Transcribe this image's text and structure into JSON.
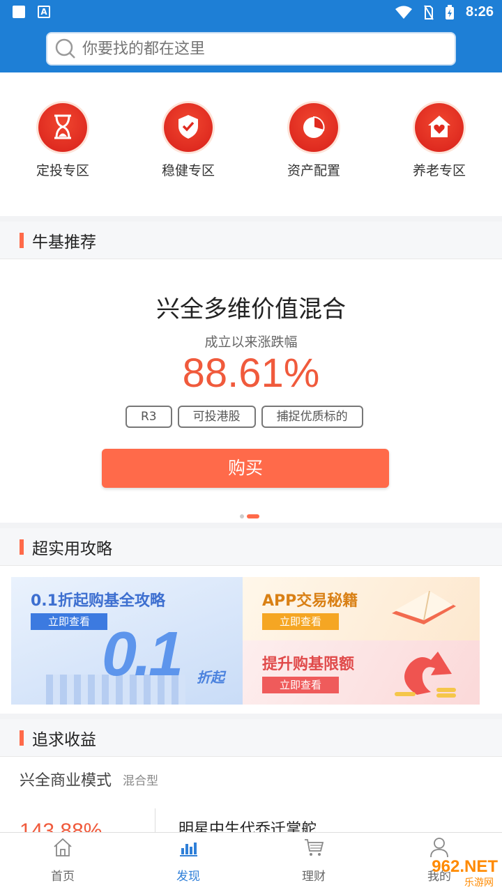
{
  "status_bar": {
    "time": "8:26"
  },
  "search": {
    "placeholder": "你要找的都在这里"
  },
  "categories": [
    {
      "label": "定投专区",
      "icon": "hourglass-icon"
    },
    {
      "label": "稳健专区",
      "icon": "shield-check-icon"
    },
    {
      "label": "资产配置",
      "icon": "pie-chart-icon"
    },
    {
      "label": "养老专区",
      "icon": "house-heart-icon"
    }
  ],
  "recommend": {
    "section_title": "牛基推荐",
    "fund_name": "兴全多维价值混合",
    "subtitle": "成立以来涨跌幅",
    "value": "88.61%",
    "tags": [
      "R3",
      "可投港股",
      "捕捉优质标的"
    ],
    "buy_label": "购买"
  },
  "strategy": {
    "section_title": "超实用攻略",
    "banners": [
      {
        "title": "0.1折起购基全攻略",
        "button": "立即查看",
        "big_text": "0.1",
        "badge": "折起"
      },
      {
        "title": "APP交易秘籍",
        "button": "立即查看"
      },
      {
        "title": "提升购基限额",
        "button": "立即查看"
      }
    ]
  },
  "pursue": {
    "section_title": "追求收益",
    "fund_name": "兴全商业模式",
    "fund_type": "混合型",
    "value": "143.88%",
    "desc": "明星中生代乔迁掌舵"
  },
  "nav": [
    {
      "label": "首页",
      "icon": "home-icon"
    },
    {
      "label": "发现",
      "icon": "bar-chart-icon",
      "active": true
    },
    {
      "label": "理财",
      "icon": "cart-icon"
    },
    {
      "label": "我的",
      "icon": "user-icon"
    }
  ],
  "watermark": {
    "brand": "962.NET",
    "sub": "乐游网"
  },
  "colors": {
    "primary_blue": "#1e7fd6",
    "accent_orange": "#ff6a4a",
    "value_red": "#f05a3c"
  }
}
